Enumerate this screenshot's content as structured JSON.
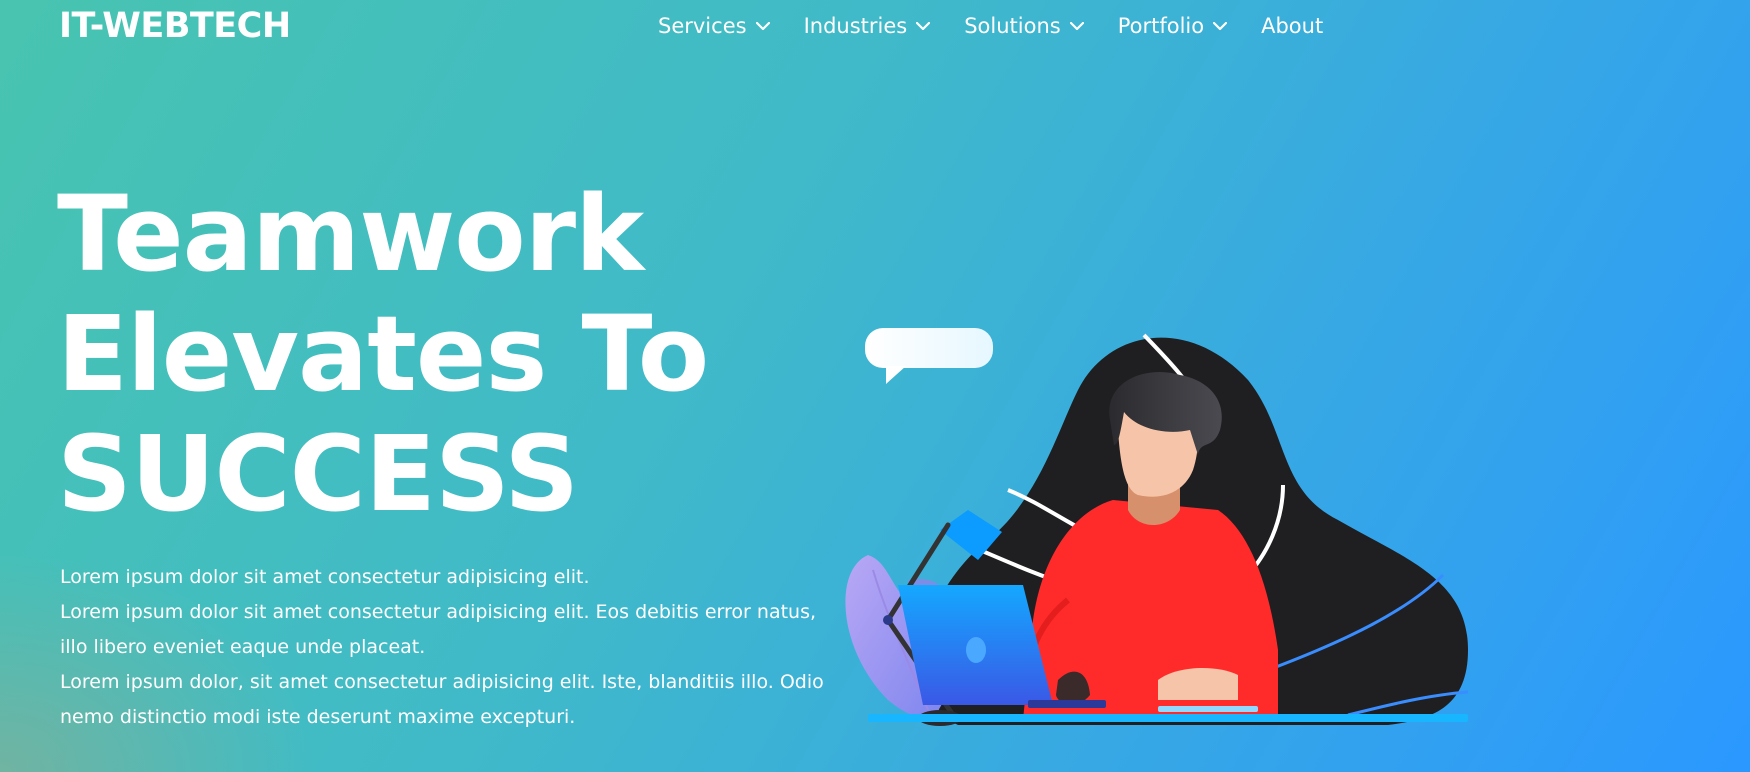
{
  "brand": {
    "logo": "IT-WEBTECH"
  },
  "nav": {
    "items": [
      {
        "label": "Services",
        "dropdown": true
      },
      {
        "label": "Industries",
        "dropdown": true
      },
      {
        "label": "Solutions",
        "dropdown": true
      },
      {
        "label": "Portfolio",
        "dropdown": true
      },
      {
        "label": "About",
        "dropdown": false
      }
    ]
  },
  "hero": {
    "title_lines": [
      "Teamwork",
      "Elevates To",
      "SUCCESS"
    ],
    "paragraphs": [
      "Lorem ipsum dolor sit amet consectetur adipisicing elit.",
      "Lorem ipsum dolor sit amet consectetur adipisicing elit. Eos debitis error natus, illo libero eveniet eaque unde placeat.",
      "Lorem ipsum dolor, sit amet consectetur adipisicing elit. Iste, blanditiis illo. Odio nemo distinctio modi iste deserunt maxime excepturi."
    ]
  },
  "colors": {
    "gradient_start": "#48c4b0",
    "gradient_end": "#2a98ff",
    "text": "#ffffff",
    "shirt": "#ff2b2b",
    "blob": "#1f1f22",
    "laptop": "#1e7bff",
    "plant": "#a89bf0"
  }
}
